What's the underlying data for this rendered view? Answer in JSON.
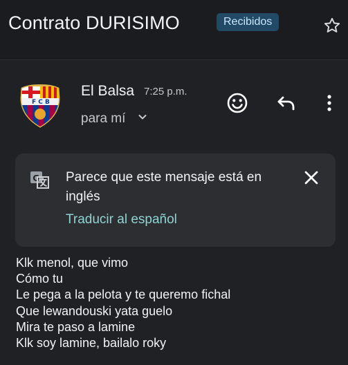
{
  "header": {
    "subject": "Contrato DURISIMO",
    "label": "Recibidos"
  },
  "message": {
    "sender": "El Balsa",
    "time": "7:25 p.m.",
    "recipient": "para mí",
    "body_lines": [
      "Klk menol, que vimo",
      "Cómo tu",
      "Le pega a la pelota y te queremo fichal",
      "Que lewandouski yata guelo",
      "Mira te paso a lamine",
      "Klk soy lamine, bailalo roky"
    ]
  },
  "translation": {
    "message": "Parece que este mensaje está en inglés",
    "action": "Traducir al español"
  },
  "icons": {
    "star": "star-icon",
    "emoji": "emoji-icon",
    "reply": "reply-icon",
    "more": "more-vert-icon",
    "translate": "translate-icon",
    "close": "close-icon"
  },
  "colors": {
    "background": "#1b1c1f",
    "label_chip": "#224a67",
    "banner": "#2d2e31",
    "link": "#8ed4d4"
  }
}
